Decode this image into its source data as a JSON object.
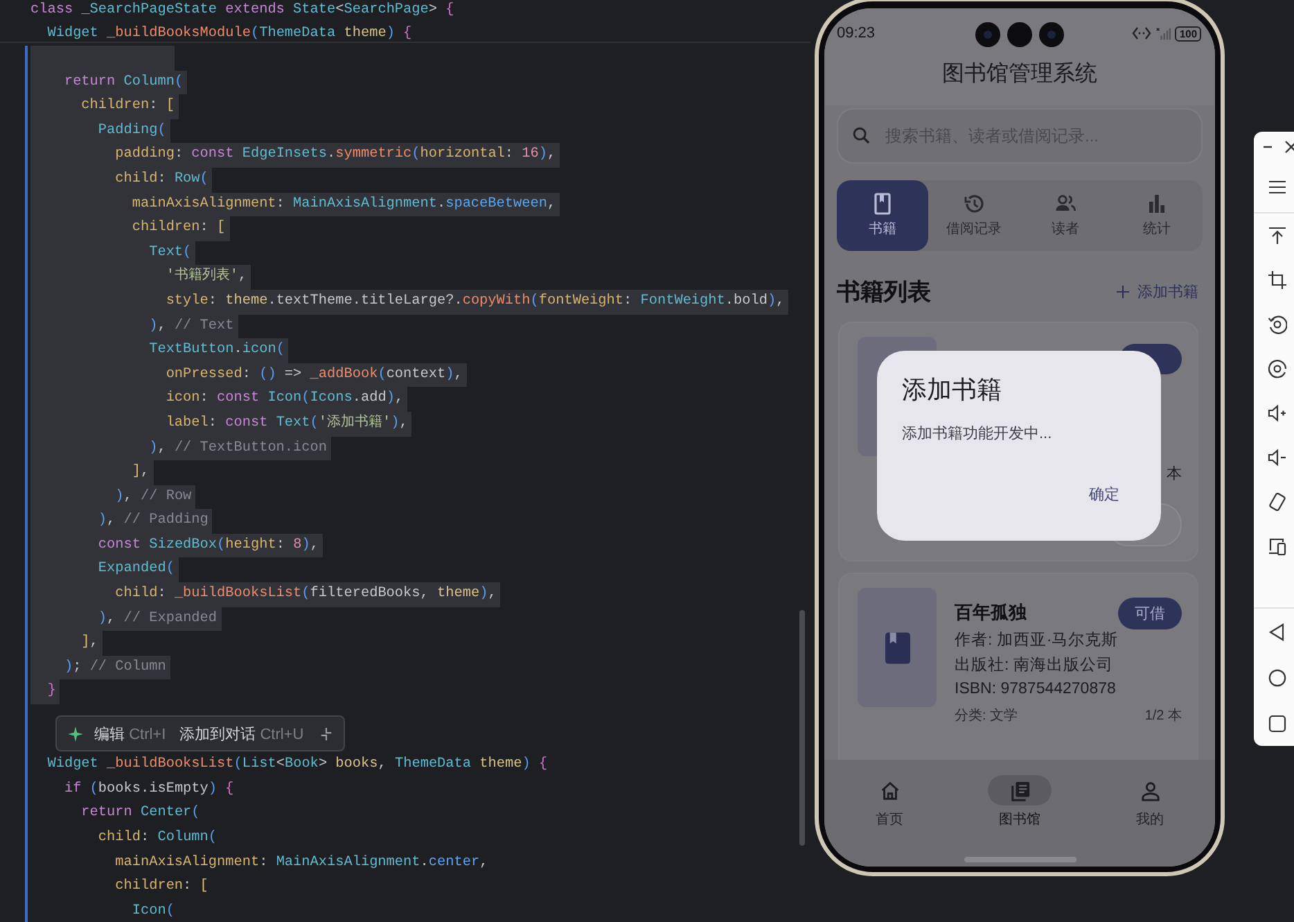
{
  "editor": {
    "sticky_lines": [
      {
        "tokens": [
          {
            "kind": "keyword",
            "text": "class"
          },
          {
            "kind": "type",
            "text": " _SearchPageState"
          },
          {
            "kind": "keyword",
            "text": " extends"
          },
          {
            "kind": "type",
            "text": " State"
          },
          {
            "kind": "plain",
            "text": "<"
          },
          {
            "kind": "type",
            "text": "SearchPage"
          },
          {
            "kind": "plain",
            "text": ">"
          },
          {
            "kind": "brace",
            "text": " {"
          }
        ]
      },
      {
        "tokens": [
          {
            "kind": "type",
            "text": "  Widget"
          },
          {
            "kind": "function",
            "text": " _buildBooksModule"
          },
          {
            "kind": "paren",
            "text": "("
          },
          {
            "kind": "type",
            "text": "ThemeData"
          },
          {
            "kind": "variable",
            "text": " theme"
          },
          {
            "kind": "paren",
            "text": ")"
          },
          {
            "kind": "brace",
            "text": " {"
          }
        ]
      }
    ],
    "lines": [
      {
        "selected": true
      },
      {
        "selected": true,
        "tokens": [
          {
            "kind": "keyword",
            "text": "    return"
          },
          {
            "kind": "type",
            "text": " Column"
          },
          {
            "kind": "paren",
            "text": "("
          }
        ]
      },
      {
        "selected": true,
        "tokens": [
          {
            "kind": "param",
            "text": "      children"
          },
          {
            "kind": "plain",
            "text": ":"
          },
          {
            "kind": "bracket",
            "text": " ["
          }
        ]
      },
      {
        "selected": true,
        "tokens": [
          {
            "kind": "type",
            "text": "        Padding"
          },
          {
            "kind": "paren",
            "text": "("
          }
        ]
      },
      {
        "selected": true,
        "tokens": [
          {
            "kind": "param",
            "text": "          padding"
          },
          {
            "kind": "plain",
            "text": ":"
          },
          {
            "kind": "keyword",
            "text": " const"
          },
          {
            "kind": "type",
            "text": " EdgeInsets"
          },
          {
            "kind": "plain",
            "text": "."
          },
          {
            "kind": "function",
            "text": "symmetric"
          },
          {
            "kind": "paren",
            "text": "("
          },
          {
            "kind": "param",
            "text": "horizontal"
          },
          {
            "kind": "plain",
            "text": ":"
          },
          {
            "kind": "number",
            "text": " 16"
          },
          {
            "kind": "paren",
            "text": ")"
          },
          {
            "kind": "plain",
            "text": ","
          }
        ]
      },
      {
        "selected": true,
        "tokens": [
          {
            "kind": "param",
            "text": "          child"
          },
          {
            "kind": "plain",
            "text": ":"
          },
          {
            "kind": "type",
            "text": " Row"
          },
          {
            "kind": "paren",
            "text": "("
          }
        ]
      },
      {
        "selected": true,
        "tokens": [
          {
            "kind": "param",
            "text": "            mainAxisAlignment"
          },
          {
            "kind": "plain",
            "text": ":"
          },
          {
            "kind": "type",
            "text": " MainAxisAlignment"
          },
          {
            "kind": "plain",
            "text": "."
          },
          {
            "kind": "member",
            "text": "spaceBetween"
          },
          {
            "kind": "plain",
            "text": ","
          }
        ]
      },
      {
        "selected": true,
        "tokens": [
          {
            "kind": "param",
            "text": "            children"
          },
          {
            "kind": "plain",
            "text": ":"
          },
          {
            "kind": "bracket",
            "text": " ["
          }
        ]
      },
      {
        "selected": true,
        "tokens": [
          {
            "kind": "type",
            "text": "              Text"
          },
          {
            "kind": "paren",
            "text": "("
          }
        ]
      },
      {
        "selected": true,
        "tokens": [
          {
            "kind": "string",
            "text": "                '书籍列表'"
          },
          {
            "kind": "plain",
            "text": ","
          }
        ]
      },
      {
        "selected": true,
        "tokens": [
          {
            "kind": "param",
            "text": "                style"
          },
          {
            "kind": "plain",
            "text": ":"
          },
          {
            "kind": "variable",
            "text": " theme"
          },
          {
            "kind": "plain",
            "text": ".textTheme.titleLarge?."
          },
          {
            "kind": "function",
            "text": "copyWith"
          },
          {
            "kind": "paren",
            "text": "("
          },
          {
            "kind": "param",
            "text": "fontWeight"
          },
          {
            "kind": "plain",
            "text": ":"
          },
          {
            "kind": "type",
            "text": " FontWeight"
          },
          {
            "kind": "plain",
            "text": ".bold"
          },
          {
            "kind": "paren",
            "text": ")"
          },
          {
            "kind": "plain",
            "text": ","
          }
        ]
      },
      {
        "selected": true,
        "tokens": [
          {
            "kind": "paren",
            "text": "              )"
          },
          {
            "kind": "plain",
            "text": ","
          },
          {
            "kind": "comment",
            "text": " // Text"
          }
        ]
      },
      {
        "selected": true,
        "tokens": [
          {
            "kind": "type",
            "text": "              TextButton"
          },
          {
            "kind": "plain",
            "text": "."
          },
          {
            "kind": "type",
            "text": "icon"
          },
          {
            "kind": "paren",
            "text": "("
          }
        ]
      },
      {
        "selected": true,
        "tokens": [
          {
            "kind": "param",
            "text": "                onPressed"
          },
          {
            "kind": "plain",
            "text": ":"
          },
          {
            "kind": "paren",
            "text": " ()"
          },
          {
            "kind": "plain",
            "text": " =>"
          },
          {
            "kind": "function",
            "text": " _addBook"
          },
          {
            "kind": "paren",
            "text": "("
          },
          {
            "kind": "plain",
            "text": "context"
          },
          {
            "kind": "paren",
            "text": ")"
          },
          {
            "kind": "plain",
            "text": ","
          }
        ]
      },
      {
        "selected": true,
        "tokens": [
          {
            "kind": "param",
            "text": "                icon"
          },
          {
            "kind": "plain",
            "text": ":"
          },
          {
            "kind": "keyword",
            "text": " const"
          },
          {
            "kind": "type",
            "text": " Icon"
          },
          {
            "kind": "paren",
            "text": "("
          },
          {
            "kind": "type",
            "text": "Icons"
          },
          {
            "kind": "plain",
            "text": ".add"
          },
          {
            "kind": "paren",
            "text": ")"
          },
          {
            "kind": "plain",
            "text": ","
          }
        ]
      },
      {
        "selected": true,
        "tokens": [
          {
            "kind": "param",
            "text": "                label"
          },
          {
            "kind": "plain",
            "text": ":"
          },
          {
            "kind": "keyword",
            "text": " const"
          },
          {
            "kind": "type",
            "text": " Text"
          },
          {
            "kind": "paren",
            "text": "("
          },
          {
            "kind": "string",
            "text": "'添加书籍'"
          },
          {
            "kind": "paren",
            "text": ")"
          },
          {
            "kind": "plain",
            "text": ","
          }
        ]
      },
      {
        "selected": true,
        "tokens": [
          {
            "kind": "paren",
            "text": "              )"
          },
          {
            "kind": "plain",
            "text": ","
          },
          {
            "kind": "comment",
            "text": " // TextButton.icon"
          }
        ]
      },
      {
        "selected": true,
        "tokens": [
          {
            "kind": "bracket",
            "text": "            ]"
          },
          {
            "kind": "plain",
            "text": ","
          }
        ]
      },
      {
        "selected": true,
        "tokens": [
          {
            "kind": "paren",
            "text": "          )"
          },
          {
            "kind": "plain",
            "text": ","
          },
          {
            "kind": "comment",
            "text": " // Row"
          }
        ]
      },
      {
        "selected": true,
        "tokens": [
          {
            "kind": "paren",
            "text": "        )"
          },
          {
            "kind": "plain",
            "text": ","
          },
          {
            "kind": "comment",
            "text": " // Padding"
          }
        ]
      },
      {
        "selected": true,
        "tokens": [
          {
            "kind": "keyword",
            "text": "        const"
          },
          {
            "kind": "type",
            "text": " SizedBox"
          },
          {
            "kind": "paren",
            "text": "("
          },
          {
            "kind": "param",
            "text": "height"
          },
          {
            "kind": "plain",
            "text": ":"
          },
          {
            "kind": "number",
            "text": " 8"
          },
          {
            "kind": "paren",
            "text": ")"
          },
          {
            "kind": "plain",
            "text": ","
          }
        ]
      },
      {
        "selected": true,
        "tokens": [
          {
            "kind": "type",
            "text": "        Expanded"
          },
          {
            "kind": "paren",
            "text": "("
          }
        ]
      },
      {
        "selected": true,
        "tokens": [
          {
            "kind": "param",
            "text": "          child"
          },
          {
            "kind": "plain",
            "text": ":"
          },
          {
            "kind": "function",
            "text": " _buildBooksList"
          },
          {
            "kind": "paren",
            "text": "("
          },
          {
            "kind": "plain",
            "text": "filteredBooks,"
          },
          {
            "kind": "variable",
            "text": " theme"
          },
          {
            "kind": "paren",
            "text": ")"
          },
          {
            "kind": "plain",
            "text": ","
          }
        ]
      },
      {
        "selected": true,
        "tokens": [
          {
            "kind": "paren",
            "text": "        )"
          },
          {
            "kind": "plain",
            "text": ","
          },
          {
            "kind": "comment",
            "text": " // Expanded"
          }
        ]
      },
      {
        "selected": true,
        "tokens": [
          {
            "kind": "bracket",
            "text": "      ]"
          },
          {
            "kind": "plain",
            "text": ","
          }
        ]
      },
      {
        "selected": true,
        "tokens": [
          {
            "kind": "paren",
            "text": "    )"
          },
          {
            "kind": "plain",
            "text": ";"
          },
          {
            "kind": "comment",
            "text": " // Column"
          }
        ]
      },
      {
        "selected": true,
        "tokens": [
          {
            "kind": "brace",
            "text": "  }"
          }
        ]
      },
      {
        "selected": false
      },
      {
        "selected": false
      },
      {
        "selected": false,
        "tokens": [
          {
            "kind": "type",
            "text": "  Widget"
          },
          {
            "kind": "function",
            "text": " _buildBooksList"
          },
          {
            "kind": "paren",
            "text": "("
          },
          {
            "kind": "type",
            "text": "List"
          },
          {
            "kind": "plain",
            "text": "<"
          },
          {
            "kind": "type",
            "text": "Book"
          },
          {
            "kind": "plain",
            "text": ">"
          },
          {
            "kind": "variable",
            "text": " books"
          },
          {
            "kind": "plain",
            "text": ","
          },
          {
            "kind": "type",
            "text": " ThemeData"
          },
          {
            "kind": "variable",
            "text": " theme"
          },
          {
            "kind": "paren",
            "text": ")"
          },
          {
            "kind": "brace",
            "text": " {"
          }
        ]
      },
      {
        "selected": false,
        "tokens": [
          {
            "kind": "keyword",
            "text": "    if"
          },
          {
            "kind": "paren",
            "text": " ("
          },
          {
            "kind": "plain",
            "text": "books.isEmpty"
          },
          {
            "kind": "paren",
            "text": ")"
          },
          {
            "kind": "brace",
            "text": " {"
          }
        ]
      },
      {
        "selected": false,
        "tokens": [
          {
            "kind": "keyword",
            "text": "      return"
          },
          {
            "kind": "type",
            "text": " Center"
          },
          {
            "kind": "paren",
            "text": "("
          }
        ]
      },
      {
        "selected": false,
        "tokens": [
          {
            "kind": "param",
            "text": "        child"
          },
          {
            "kind": "plain",
            "text": ":"
          },
          {
            "kind": "type",
            "text": " Column"
          },
          {
            "kind": "paren",
            "text": "("
          }
        ]
      },
      {
        "selected": false,
        "tokens": [
          {
            "kind": "param",
            "text": "          mainAxisAlignment"
          },
          {
            "kind": "plain",
            "text": ":"
          },
          {
            "kind": "type",
            "text": " MainAxisAlignment"
          },
          {
            "kind": "plain",
            "text": "."
          },
          {
            "kind": "member",
            "text": "center"
          },
          {
            "kind": "plain",
            "text": ","
          }
        ]
      },
      {
        "selected": false,
        "tokens": [
          {
            "kind": "param",
            "text": "          children"
          },
          {
            "kind": "plain",
            "text": ":"
          },
          {
            "kind": "bracket",
            "text": " ["
          }
        ]
      },
      {
        "selected": false,
        "tokens": [
          {
            "kind": "type",
            "text": "            Icon"
          },
          {
            "kind": "paren",
            "text": "("
          }
        ]
      }
    ],
    "popup": {
      "actions": [
        {
          "label": "编辑",
          "shortcut": "Ctrl+I"
        },
        {
          "label": "添加到对话",
          "shortcut": "Ctrl+U"
        }
      ]
    }
  },
  "phone": {
    "status_bar": {
      "time": "09:23",
      "battery": "100"
    },
    "app_title": "图书馆管理系统",
    "search": {
      "placeholder": "搜索书籍、读者或借阅记录..."
    },
    "tabs": [
      {
        "label": "书籍",
        "selected": true
      },
      {
        "label": "借阅记录",
        "selected": false
      },
      {
        "label": "读者",
        "selected": false
      },
      {
        "label": "统计",
        "selected": false
      }
    ],
    "section": {
      "title": "书籍列表",
      "action": "添加书籍"
    },
    "books": [
      {
        "kind": "covered",
        "stock": "本"
      },
      {
        "kind": "full",
        "title": "百年孤独",
        "status": "可借",
        "author": "作者: 加西亚·马尔克斯",
        "publisher": "出版社: 南海出版公司",
        "isbn": "ISBN: 9787544270878",
        "category": "分类: 文学",
        "stock": "1/2 本"
      }
    ],
    "bottom_nav": [
      {
        "label": "首页",
        "selected": false
      },
      {
        "label": "图书馆",
        "selected": true
      },
      {
        "label": "我的",
        "selected": false
      }
    ],
    "dialog": {
      "title": "添加书籍",
      "message": "添加书籍功能开发中...",
      "button": "确定"
    }
  }
}
